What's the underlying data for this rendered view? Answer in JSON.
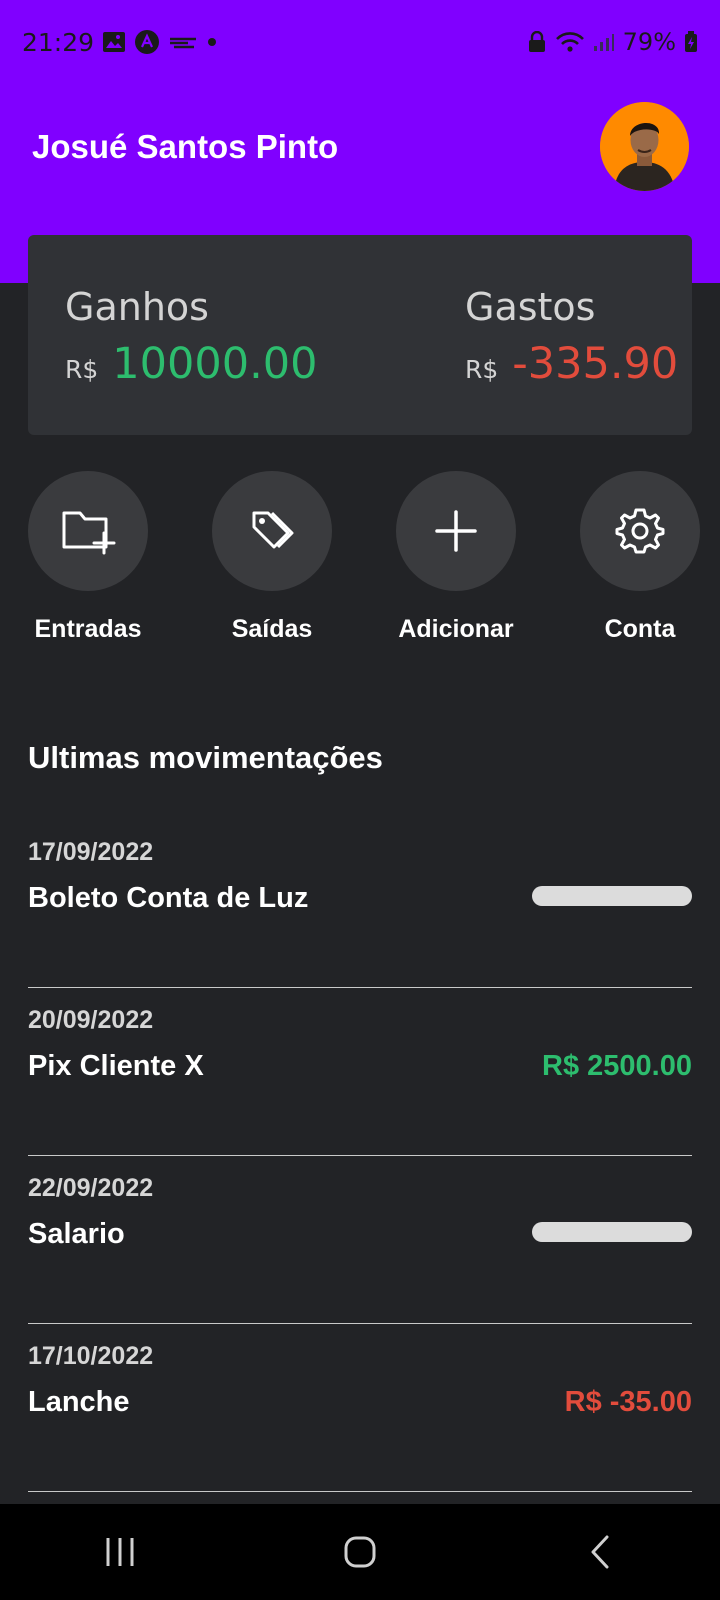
{
  "status_bar": {
    "time": "21:29",
    "battery": "79%",
    "icons": [
      "gallery-icon",
      "app-icon",
      "notification-app-icon",
      "dot-icon",
      "lock-icon",
      "wifi-icon",
      "signal-icon",
      "battery-icon"
    ]
  },
  "header": {
    "user_name": "Josué Santos Pinto",
    "accent_color": "#8000ff"
  },
  "summary": {
    "income": {
      "label": "Ganhos",
      "currency": "R$",
      "amount": "10000.00",
      "color": "#2dbd6e"
    },
    "expense": {
      "label": "Gastos",
      "currency": "R$",
      "amount": "-335.90",
      "color": "#e24c3c"
    }
  },
  "actions": [
    {
      "label": "Entradas",
      "icon": "folder-plus-icon"
    },
    {
      "label": "Saídas",
      "icon": "tags-icon"
    },
    {
      "label": "Adicionar",
      "icon": "plus-icon"
    },
    {
      "label": "Conta",
      "icon": "gear-icon"
    }
  ],
  "transactions_section": {
    "title": "Ultimas movimentações",
    "items": [
      {
        "date": "17/09/2022",
        "description": "Boleto Conta de Luz",
        "amount": "",
        "masked": true
      },
      {
        "date": "20/09/2022",
        "description": "Pix Cliente X",
        "amount": "R$ 2500.00",
        "masked": false,
        "type": "positive"
      },
      {
        "date": "22/09/2022",
        "description": "Salario",
        "amount": "",
        "masked": true
      },
      {
        "date": "17/10/2022",
        "description": "Lanche",
        "amount": "R$ -35.00",
        "masked": false,
        "type": "negative"
      }
    ]
  },
  "nav_bar": {
    "buttons": [
      "recent-apps-icon",
      "home-icon",
      "back-icon"
    ]
  }
}
